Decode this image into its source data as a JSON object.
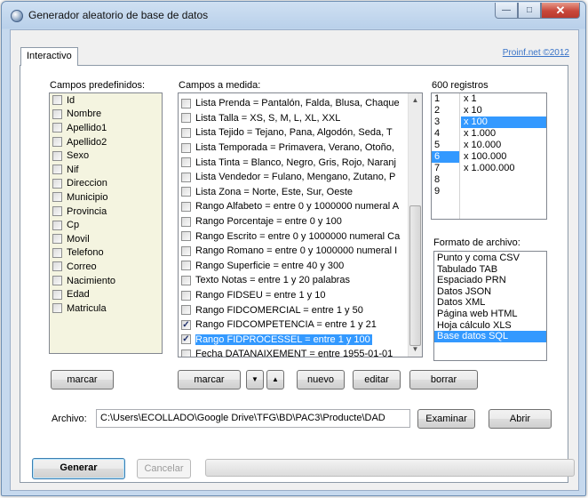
{
  "window": {
    "title": "Generador aleatorio de base de datos"
  },
  "tabs": [
    {
      "label": "Interactivo"
    }
  ],
  "credit": "Proinf.net ©2012",
  "predefined": {
    "label": "Campos predefinidos:",
    "items": [
      "Id",
      "Nombre",
      "Apellido1",
      "Apellido2",
      "Sexo",
      "Nif",
      "Direccion",
      "Municipio",
      "Provincia",
      "Cp",
      "Movil",
      "Telefono",
      "Correo",
      "Nacimiento",
      "Edad",
      "Matricula"
    ],
    "mark_label": "marcar"
  },
  "custom": {
    "label": "Campos a medida:",
    "items": [
      {
        "text": "Lista Prenda = Pantalón, Falda, Blusa, Chaque",
        "checked": false,
        "selected": false
      },
      {
        "text": "Lista Talla = XS, S, M, L, XL, XXL",
        "checked": false,
        "selected": false
      },
      {
        "text": "Lista Tejido = Tejano, Pana, Algodón, Seda, T",
        "checked": false,
        "selected": false
      },
      {
        "text": "Lista Temporada = Primavera, Verano, Otoño,",
        "checked": false,
        "selected": false
      },
      {
        "text": "Lista Tinta = Blanco, Negro, Gris, Rojo, Naranj",
        "checked": false,
        "selected": false
      },
      {
        "text": "Lista Vendedor = Fulano, Mengano, Zutano, P",
        "checked": false,
        "selected": false
      },
      {
        "text": "Lista Zona = Norte, Este, Sur, Oeste",
        "checked": false,
        "selected": false
      },
      {
        "text": "Rango Alfabeto = entre 0 y 1000000 numeral A",
        "checked": false,
        "selected": false
      },
      {
        "text": "Rango Porcentaje = entre 0 y 100",
        "checked": false,
        "selected": false
      },
      {
        "text": "Rango Escrito = entre 0 y 1000000 numeral Ca",
        "checked": false,
        "selected": false
      },
      {
        "text": "Rango Romano = entre 0 y 1000000 numeral I",
        "checked": false,
        "selected": false
      },
      {
        "text": "Rango Superficie = entre 40 y 300",
        "checked": false,
        "selected": false
      },
      {
        "text": "Texto Notas = entre 1 y 20 palabras",
        "checked": false,
        "selected": false
      },
      {
        "text": "Rango FIDSEU = entre 1 y 10",
        "checked": false,
        "selected": false
      },
      {
        "text": "Rango FIDCOMERCIAL = entre 1 y 50",
        "checked": false,
        "selected": false
      },
      {
        "text": "Rango FIDCOMPETENCIA = entre 1 y 21",
        "checked": true,
        "selected": false
      },
      {
        "text": "Rango FIDPROCESSEL = entre 1 y 100",
        "checked": true,
        "selected": true
      },
      {
        "text": "Fecha DATANAIXEMENT = entre 1955-01-01",
        "checked": false,
        "selected": false
      }
    ],
    "mark_label": "marcar",
    "down_glyph": "▼",
    "up_glyph": "▲",
    "new_label": "nuevo",
    "edit_label": "editar",
    "delete_label": "borrar"
  },
  "records": {
    "label": "600 registros",
    "numbers": [
      "1",
      "2",
      "3",
      "4",
      "5",
      "6",
      "7",
      "8",
      "9"
    ],
    "multipliers": [
      "x 1",
      "x 10",
      "x 100",
      "x 1.000",
      "x 10.000",
      "x 100.000",
      "x 1.000.000"
    ],
    "selected_number_index": 5,
    "selected_multiplier_index": 2
  },
  "format": {
    "label": "Formato de archivo:",
    "options": [
      "Punto y coma CSV",
      "Tabulado TAB",
      "Espaciado PRN",
      "Datos JSON",
      "Datos XML",
      "Página web HTML",
      "Hoja cálculo XLS",
      "Base datos SQL"
    ],
    "selected_index": 7
  },
  "file": {
    "label": "Archivo:",
    "value": "C:\\Users\\ECOLLADO\\Google Drive\\TFG\\BD\\PAC3\\Producte\\DAD",
    "browse_label": "Examinar",
    "open_label": "Abrir"
  },
  "footer": {
    "generate_label": "Generar",
    "cancel_label": "Cancelar",
    "progress": 0
  },
  "colors": {
    "selection": "#3399ff",
    "predefined_bg": "#f4f4e0",
    "credit_link": "#3a74c8"
  }
}
